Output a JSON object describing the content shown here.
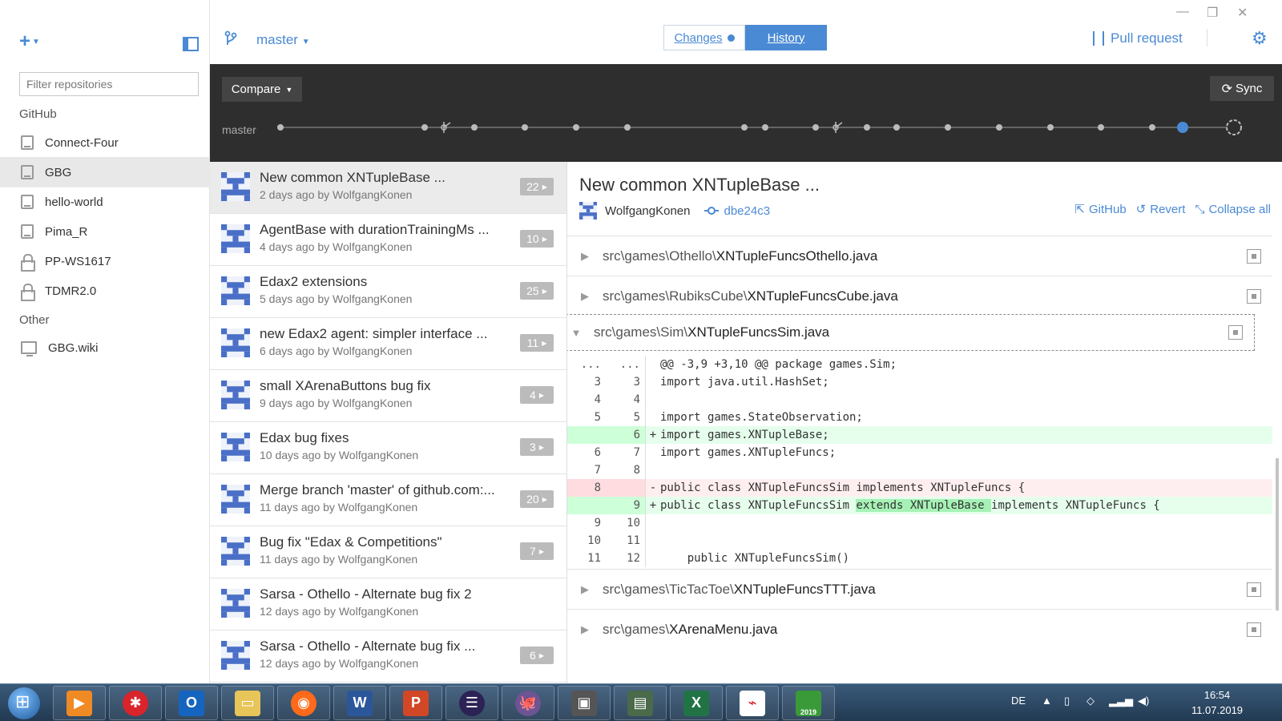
{
  "sidebar": {
    "filter_placeholder": "Filter repositories",
    "sections": [
      {
        "title": "GitHub",
        "items": [
          {
            "label": "Connect-Four",
            "icon": "book-icon",
            "active": false
          },
          {
            "label": "GBG",
            "icon": "book-icon",
            "active": true
          },
          {
            "label": "hello-world",
            "icon": "book-icon",
            "active": false
          },
          {
            "label": "Pima_R",
            "icon": "book-icon",
            "active": false
          },
          {
            "label": "PP-WS1617",
            "icon": "lock-icon",
            "active": false
          },
          {
            "label": "TDMR2.0",
            "icon": "lock-icon",
            "active": false
          }
        ]
      },
      {
        "title": "Other",
        "items": [
          {
            "label": "GBG.wiki",
            "icon": "monitor-icon",
            "active": false
          }
        ]
      }
    ]
  },
  "header": {
    "branch": "master",
    "tabs": [
      {
        "label": "Changes",
        "active": false
      },
      {
        "label": "History",
        "active": true
      }
    ],
    "pull_request": "Pull request"
  },
  "timeline": {
    "compare": "Compare",
    "sync": "Sync",
    "branch_label": "master"
  },
  "commits": [
    {
      "title": "New common XNTupleBase ...",
      "meta": "2 days ago by WolfgangKonen",
      "count": "22",
      "active": true
    },
    {
      "title": "AgentBase with durationTrainingMs ...",
      "meta": "4 days ago by WolfgangKonen",
      "count": "10",
      "active": false
    },
    {
      "title": "Edax2 extensions",
      "meta": "5 days ago by WolfgangKonen",
      "count": "25",
      "active": false
    },
    {
      "title": "new Edax2 agent: simpler interface ...",
      "meta": "6 days ago by WolfgangKonen",
      "count": "11",
      "active": false
    },
    {
      "title": "small XArenaButtons bug fix",
      "meta": "9 days ago by WolfgangKonen",
      "count": "4",
      "active": false
    },
    {
      "title": "Edax bug fixes",
      "meta": "10 days ago by WolfgangKonen",
      "count": "3",
      "active": false
    },
    {
      "title": "Merge branch 'master' of github.com:...",
      "meta": "11 days ago by WolfgangKonen",
      "count": "20",
      "active": false
    },
    {
      "title": "Bug fix \"Edax & Competitions\"",
      "meta": "11 days ago by WolfgangKonen",
      "count": "7",
      "active": false
    },
    {
      "title": "Sarsa - Othello - Alternate bug fix 2",
      "meta": "12 days ago by WolfgangKonen",
      "count": "",
      "active": false
    },
    {
      "title": "Sarsa - Othello - Alternate bug fix ...",
      "meta": "12 days ago by WolfgangKonen",
      "count": "6",
      "active": false
    }
  ],
  "detail": {
    "title": "New common XNTupleBase ...",
    "author": "WolfgangKonen",
    "sha": "dbe24c3",
    "actions": {
      "github": "GitHub",
      "revert": "Revert",
      "collapse": "Collapse all"
    },
    "files": [
      {
        "dir": "src\\games\\Othello\\",
        "name": "XNTupleFuncsOthello.java",
        "expanded": false
      },
      {
        "dir": "src\\games\\RubiksCube\\",
        "name": "XNTupleFuncsCube.java",
        "expanded": false
      },
      {
        "dir": "src\\games\\Sim\\",
        "name": "XNTupleFuncsSim.java",
        "expanded": true
      },
      {
        "dir": "src\\games\\TicTacToe\\",
        "name": "XNTupleFuncsTTT.java",
        "expanded": false
      },
      {
        "dir": "src\\games\\",
        "name": "XArenaMenu.java",
        "expanded": false
      }
    ],
    "diff_lines": [
      {
        "type": "hunk",
        "old": "...",
        "new": "...",
        "sign": "",
        "code": "@@ -3,9 +3,10 @@ package games.Sim;"
      },
      {
        "type": "ctx",
        "old": "3",
        "new": "3",
        "sign": "",
        "code": "import java.util.HashSet;"
      },
      {
        "type": "ctx",
        "old": "4",
        "new": "4",
        "sign": "",
        "code": ""
      },
      {
        "type": "ctx",
        "old": "5",
        "new": "5",
        "sign": "",
        "code": "import games.StateObservation;"
      },
      {
        "type": "add",
        "old": "",
        "new": "6",
        "sign": "+",
        "code": "import games.XNTupleBase;"
      },
      {
        "type": "ctx",
        "old": "6",
        "new": "7",
        "sign": "",
        "code": "import games.XNTupleFuncs;"
      },
      {
        "type": "ctx",
        "old": "7",
        "new": "8",
        "sign": "",
        "code": ""
      },
      {
        "type": "del",
        "old": "8",
        "new": "",
        "sign": "-",
        "code": "public class XNTupleFuncsSim implements XNTupleFuncs {"
      },
      {
        "type": "add-hl",
        "old": "",
        "new": "9",
        "sign": "+",
        "code_pre": "public class XNTupleFuncsSim ",
        "code_hl": "extends XNTupleBase ",
        "code_post": "implements XNTupleFuncs {"
      },
      {
        "type": "ctx",
        "old": "9",
        "new": "10",
        "sign": "",
        "code": ""
      },
      {
        "type": "ctx",
        "old": "10",
        "new": "11",
        "sign": "",
        "code": ""
      },
      {
        "type": "ctx",
        "old": "11",
        "new": "12",
        "sign": "",
        "code": "    public XNTupleFuncsSim()"
      }
    ]
  },
  "taskbar": {
    "language": "DE",
    "time": "16:54",
    "date": "11.07.2019",
    "excel_badge": "2019"
  },
  "colors": {
    "accent": "#4a8ad4",
    "dark_bar": "#2e2e2e",
    "add_bg": "#e6ffed",
    "del_bg": "#ffeef0"
  }
}
